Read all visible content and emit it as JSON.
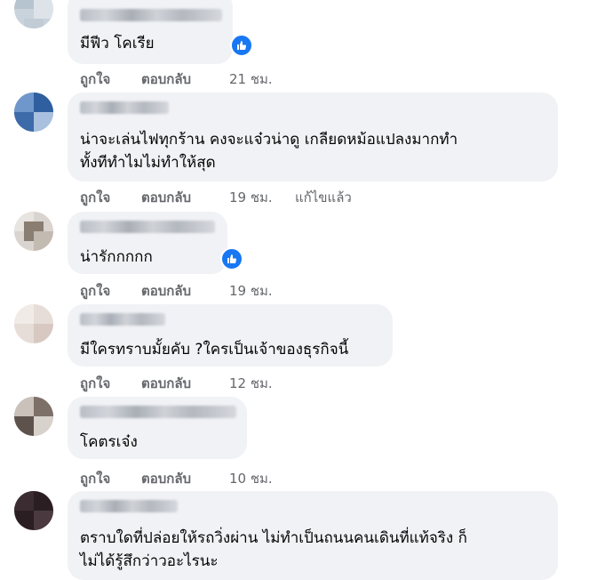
{
  "comments": [
    {
      "text": [
        "มีฟีว โคเรีย"
      ],
      "like_label": "ถูกใจ",
      "reply_label": "ตอบกลับ",
      "time": "21 ชม.",
      "edited": ""
    },
    {
      "text": [
        "น่าจะเล่นไฟทุกร้าน คงจะแจ๋วน่าดู เกลียดหม้อแปลงมากทำ",
        "ทั้งทีทำไมไม่ทำให้สุด"
      ],
      "like_label": "ถูกใจ",
      "reply_label": "ตอบกลับ",
      "time": "19 ชม.",
      "edited": "แก้ไขแล้ว"
    },
    {
      "text": [
        "น่ารักกกกก"
      ],
      "like_label": "ถูกใจ",
      "reply_label": "ตอบกลับ",
      "time": "19 ชม.",
      "edited": ""
    },
    {
      "text": [
        "มีใครทราบมั้ยคับ ?ใครเป็นเจ้าของธุรกิจนี้"
      ],
      "like_label": "ถูกใจ",
      "reply_label": "ตอบกลับ",
      "time": "12 ชม.",
      "edited": ""
    },
    {
      "text": [
        "โคตรเจ๋ง"
      ],
      "like_label": "ถูกใจ",
      "reply_label": "ตอบกลับ",
      "time": "10 ชม.",
      "edited": ""
    },
    {
      "text": [
        "ตราบใดที่ปล่อยให้รถวิ่งผ่าน ไม่ทำเป็นถนนคนเดินที่แท้จริง ก็",
        "ไม่ได้รู้สึกว่าวอะไรนะ"
      ],
      "like_label": "",
      "reply_label": "",
      "time": "",
      "edited": ""
    }
  ],
  "colors": {
    "bubble": "#f0f2f5",
    "text": "#050505",
    "secondary_text": "#65676b",
    "like_badge": "#1877f2"
  },
  "icons": {
    "reaction": "thumbs-up-icon"
  }
}
